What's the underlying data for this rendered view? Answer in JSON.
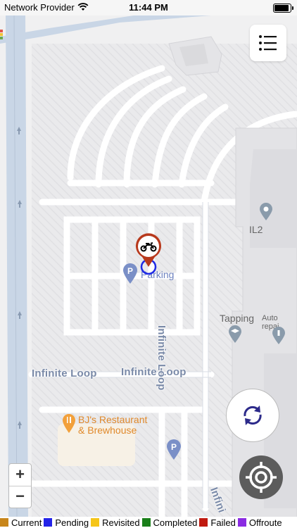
{
  "status_bar": {
    "provider": "Network Provider",
    "time": "11:44 PM"
  },
  "map": {
    "street_infinite_loop_1": "Infinite Loop",
    "street_infinite_loop_2": "Infinite Loop",
    "street_infinite_loop_3": "Infinite Loop",
    "street_infinite_partial": "Infini",
    "poi_parking": "Parking",
    "poi_il2": "IL2",
    "poi_tapping": "Tapping",
    "poi_auto_repair": "Auto repai",
    "poi_restaurant_line1": "BJ's Restaurant",
    "poi_restaurant_line2": "& Brewhouse"
  },
  "controls": {
    "zoom_in": "+",
    "zoom_out": "−",
    "list_icon": "list-icon",
    "refresh_icon": "refresh-icon",
    "locate_icon": "locate-icon"
  },
  "legend": [
    {
      "label": "Current",
      "color": "#c8861b"
    },
    {
      "label": "Pending",
      "color": "#2323e8"
    },
    {
      "label": "Revisited",
      "color": "#f5c518"
    },
    {
      "label": "Completed",
      "color": "#1a7f1a"
    },
    {
      "label": "Failed",
      "color": "#c0190f"
    },
    {
      "label": "Offroute",
      "color": "#8a2be2"
    }
  ]
}
